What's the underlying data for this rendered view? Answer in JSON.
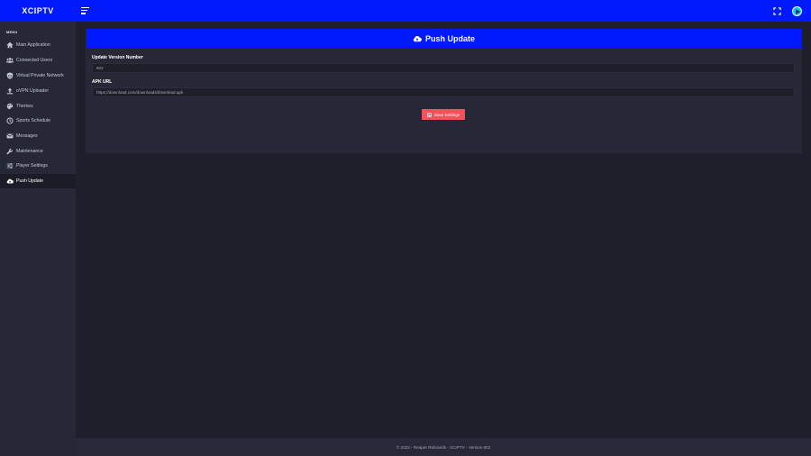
{
  "app": {
    "title": "XCIPTV"
  },
  "topbar": {
    "menu_icon": "hamburger-icon",
    "fullscreen_icon": "fullscreen-icon",
    "avatar_icon": "profile-avatar-icon"
  },
  "colors": {
    "primary": "#0019ff",
    "background": "#1e1f2b",
    "sidebar": "#262838",
    "danger": "#f0545a"
  },
  "sidebar": {
    "heading": "MENU",
    "items": [
      {
        "label": "Main Application",
        "icon": "home-icon",
        "active": false
      },
      {
        "label": "Connected Users",
        "icon": "users-icon",
        "active": false
      },
      {
        "label": "Virtual Private Network",
        "icon": "vpn-icon",
        "active": false
      },
      {
        "label": "oVPN Uploader",
        "icon": "upload-icon",
        "active": false
      },
      {
        "label": "Themes",
        "icon": "palette-icon",
        "active": false
      },
      {
        "label": "Sports Schedule",
        "icon": "clock-icon",
        "active": false
      },
      {
        "label": "Messages",
        "icon": "envelope-icon",
        "active": false
      },
      {
        "label": "Maintenance",
        "icon": "wrench-icon",
        "active": false
      },
      {
        "label": "Player Settings",
        "icon": "sliders-icon",
        "active": false
      },
      {
        "label": "Push Update",
        "icon": "cloud-upload-icon",
        "active": true
      }
    ]
  },
  "main": {
    "card_title": "Push Update",
    "card_icon": "cloud-upload-icon",
    "version_label": "Update Version Number",
    "version_value": "602",
    "apk_label": "APK URL",
    "apk_value": "https://download.com/downloads/download.apk",
    "save_label": "Save Settings",
    "save_icon": "save-icon"
  },
  "footer": {
    "text": "© 2023 - Reaper Rebrands - XCIPTV - Version 602"
  }
}
